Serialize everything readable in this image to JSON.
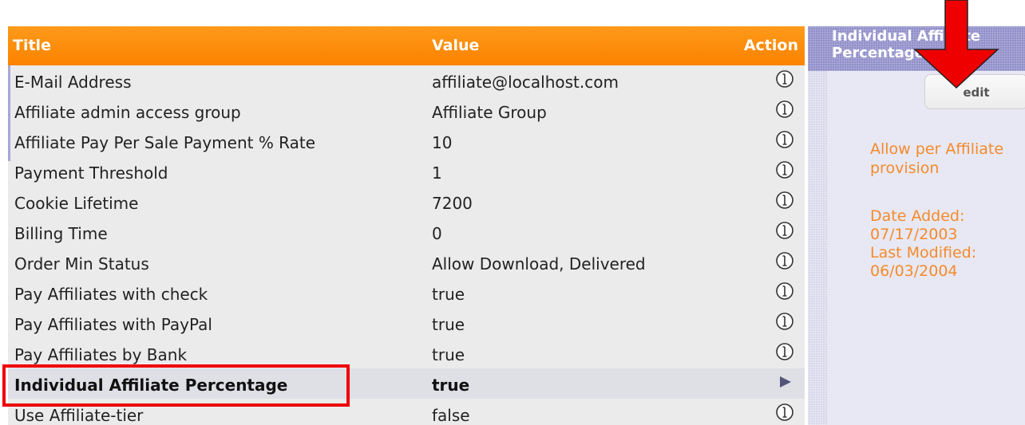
{
  "table": {
    "headers": {
      "title": "Title",
      "value": "Value",
      "action": "Action"
    },
    "rows": [
      {
        "title": "E-Mail Address",
        "value": "affiliate@localhost.com",
        "action_icon": "info-icon"
      },
      {
        "title": "Affiliate admin access group",
        "value": "Affiliate Group",
        "action_icon": "info-icon"
      },
      {
        "title": "Affiliate Pay Per Sale Payment % Rate",
        "value": "10",
        "action_icon": "info-icon"
      },
      {
        "title": "Payment Threshold",
        "value": "1",
        "action_icon": "info-icon"
      },
      {
        "title": "Cookie Lifetime",
        "value": "7200",
        "action_icon": "info-icon"
      },
      {
        "title": "Billing Time",
        "value": "0",
        "action_icon": "info-icon"
      },
      {
        "title": "Order Min Status",
        "value": "Allow Download, Delivered",
        "action_icon": "info-icon"
      },
      {
        "title": "Pay Affiliates with check",
        "value": "true",
        "action_icon": "info-icon"
      },
      {
        "title": "Pay Affiliates with PayPal",
        "value": "true",
        "action_icon": "info-icon"
      },
      {
        "title": "Pay Affiliates by Bank",
        "value": "true",
        "action_icon": "info-icon"
      },
      {
        "title": "Individual Affiliate Percentage",
        "value": "true",
        "action_icon": "arrow-right-icon",
        "selected": true
      },
      {
        "title": "Use Affiliate-tier",
        "value": "false",
        "action_icon": "info-icon"
      }
    ]
  },
  "side_panel": {
    "title": "Individual Affiliate\nPercentage",
    "edit_label": "edit",
    "description": "Allow per Affiliate\nprovision",
    "date_added_label": "Date Added:",
    "date_added": "07/17/2003",
    "last_modified_label": "Last Modified:",
    "last_modified": "06/03/2004"
  },
  "colors": {
    "header_orange": "#fb8200",
    "panel_header": "#8f8dc9",
    "panel_text": "#f58a2a",
    "annotation_red": "#ee0000"
  }
}
